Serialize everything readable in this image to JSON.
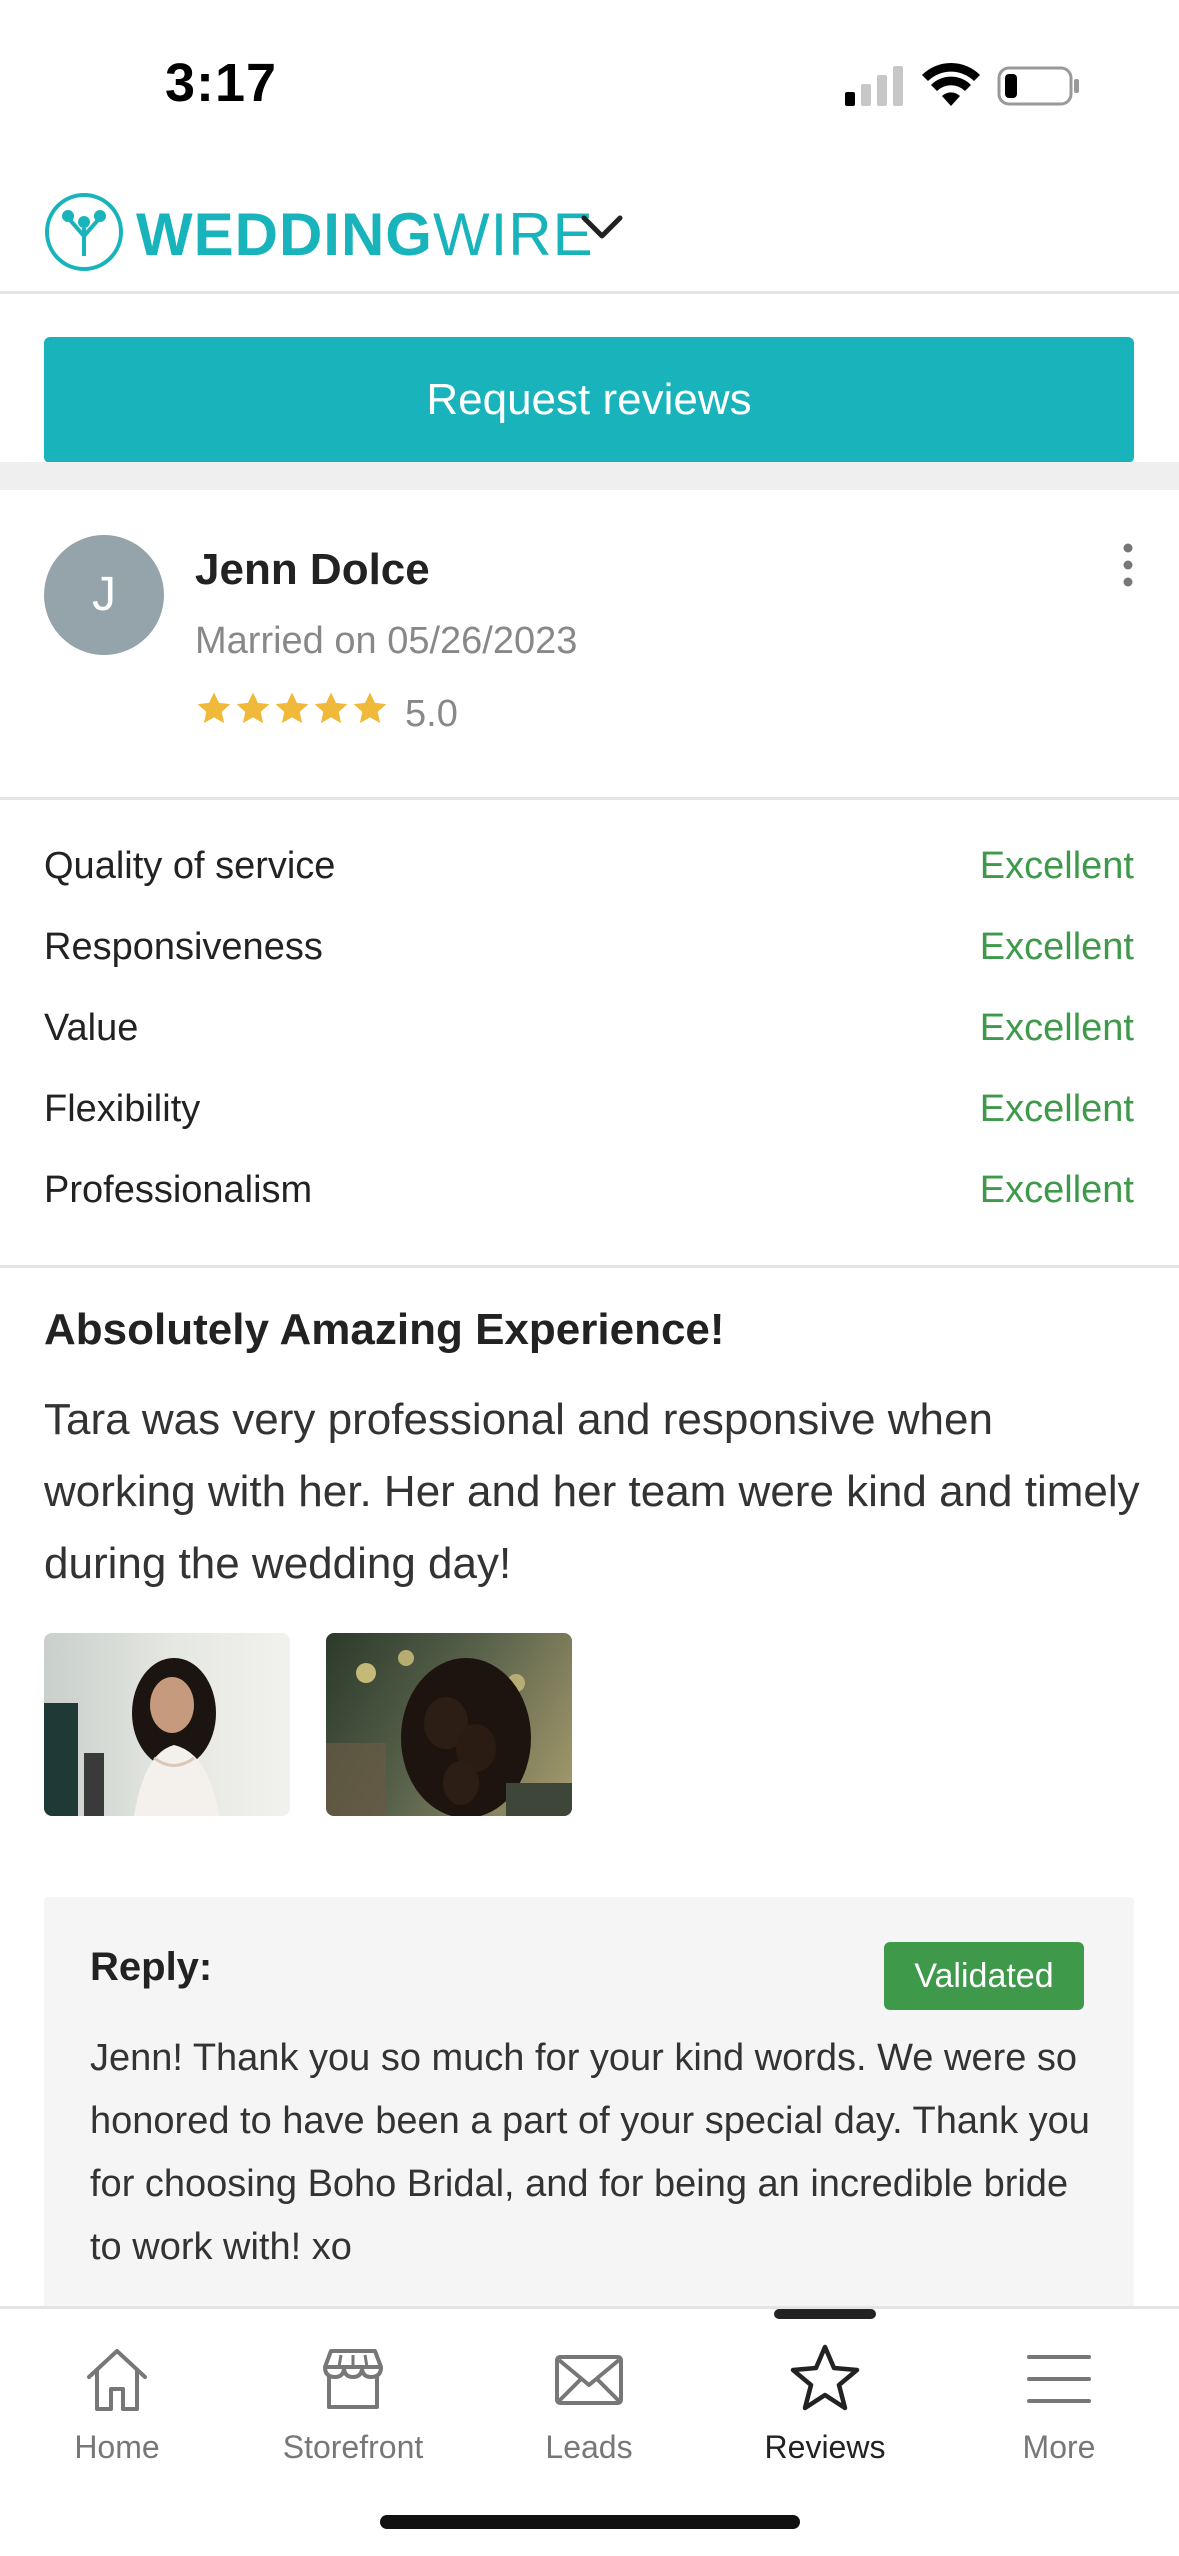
{
  "status_bar": {
    "time": "3:17"
  },
  "header": {
    "logo_bold": "WEDDING",
    "logo_light": "WIRE"
  },
  "actions": {
    "request_reviews": "Request reviews"
  },
  "review": {
    "avatar_initial": "J",
    "name": "Jenn Dolce",
    "married_on": "Married on 05/26/2023",
    "stars": 5,
    "rating": "5.0",
    "criteria": [
      {
        "label": "Quality of service",
        "value": "Excellent"
      },
      {
        "label": "Responsiveness",
        "value": "Excellent"
      },
      {
        "label": "Value",
        "value": "Excellent"
      },
      {
        "label": "Flexibility",
        "value": "Excellent"
      },
      {
        "label": "Professionalism",
        "value": "Excellent"
      }
    ],
    "title": "Absolutely Amazing Experience!",
    "body": "Tara was very professional and responsive when working with her. Her and her team were kind and timely during the wedding day!",
    "reply": {
      "label": "Reply:",
      "badge": "Validated",
      "text": "Jenn! Thank you so much for your kind words. We were so honored to have been a part of your special day. Thank you for choosing Boho Bridal, and for being an incredible bride to work with! xo"
    }
  },
  "tabs": [
    {
      "label": "Home",
      "icon": "home-icon"
    },
    {
      "label": "Storefront",
      "icon": "storefront-icon"
    },
    {
      "label": "Leads",
      "icon": "mail-icon"
    },
    {
      "label": "Reviews",
      "icon": "star-icon",
      "active": true
    },
    {
      "label": "More",
      "icon": "menu-icon"
    }
  ],
  "colors": {
    "brand": "#19b4bb",
    "excellent": "#3e9a4a",
    "star": "#f0b93a"
  }
}
